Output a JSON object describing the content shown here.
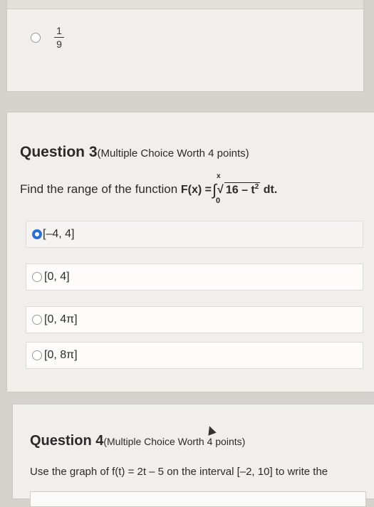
{
  "prev_question": {
    "option_label": {
      "numerator": "1",
      "denominator": "9"
    }
  },
  "question3": {
    "title": "Question 3",
    "subtitle": "(Multiple Choice Worth 4 points)",
    "prompt": "Find the range of the function",
    "function_lhs": "F(x) =",
    "integral_upper": "x",
    "integral_lower": "0",
    "integrand": "16 – t",
    "exponent": "2",
    "differential": "dt",
    "trailing": ".",
    "options": [
      {
        "label": "[–4, 4]",
        "selected": true
      },
      {
        "label": "[0, 4]",
        "selected": false
      },
      {
        "label": "[0, 4π]",
        "selected": false
      },
      {
        "label": "[0, 8π]",
        "selected": false
      }
    ]
  },
  "question4": {
    "title": "Question 4",
    "subtitle": "(Multiple Choice Worth 4 points)",
    "prompt": "Use the graph of f(t) = 2t – 5 on the interval [–2, 10] to write the"
  },
  "colors": {
    "accent": "#2d6fd3",
    "card": "#f1efec",
    "background": "#d6d3cf"
  }
}
